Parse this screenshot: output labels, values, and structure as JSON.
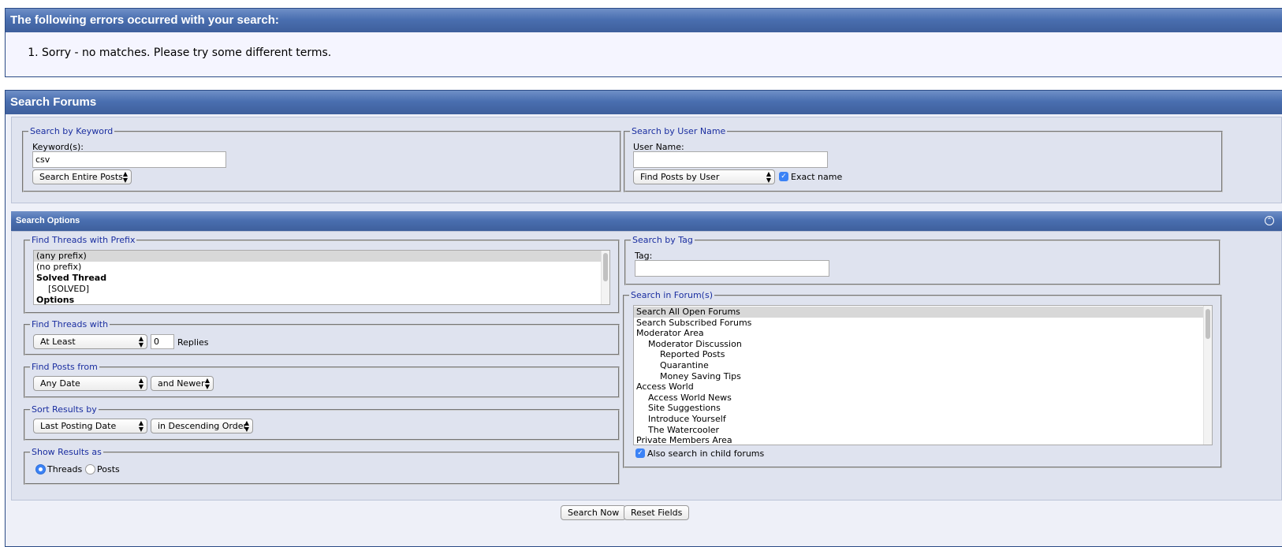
{
  "errors": {
    "title": "The following errors occurred with your search:",
    "items": [
      "Sorry - no matches. Please try some different terms."
    ]
  },
  "search": {
    "title": "Search Forums",
    "keyword": {
      "legend": "Search by Keyword",
      "label": "Keyword(s):",
      "value": "csv",
      "scope": "Search Entire Posts"
    },
    "user": {
      "legend": "Search by User Name",
      "label": "User Name:",
      "value": "",
      "mode": "Find Posts by User",
      "exact_label": "Exact name",
      "exact_checked": true
    },
    "options_title": "Search Options",
    "prefix": {
      "legend": "Find Threads with Prefix",
      "items": [
        {
          "label": "(any prefix)",
          "indent": 0,
          "bold": false,
          "selected": true
        },
        {
          "label": "(no prefix)",
          "indent": 0,
          "bold": false,
          "selected": false
        },
        {
          "label": "Solved Thread",
          "indent": 0,
          "bold": true,
          "selected": false
        },
        {
          "label": "[SOLVED]",
          "indent": 1,
          "bold": false,
          "selected": false
        },
        {
          "label": "Options",
          "indent": 0,
          "bold": true,
          "selected": false
        }
      ]
    },
    "threads_with": {
      "legend": "Find Threads with",
      "mode": "At Least",
      "replies_value": "0",
      "replies_label": "Replies"
    },
    "posts_from": {
      "legend": "Find Posts from",
      "date": "Any Date",
      "direction": "and Newer"
    },
    "sort": {
      "legend": "Sort Results by",
      "field": "Last Posting Date",
      "order": "in Descending Order"
    },
    "show_as": {
      "legend": "Show Results as",
      "threads_label": "Threads",
      "posts_label": "Posts",
      "selected": "Threads"
    },
    "tag": {
      "legend": "Search by Tag",
      "label": "Tag:",
      "value": ""
    },
    "forums": {
      "legend": "Search in Forum(s)",
      "items": [
        {
          "label": "Search All Open Forums",
          "indent": 0,
          "selected": true
        },
        {
          "label": "Search Subscribed Forums",
          "indent": 0,
          "selected": false
        },
        {
          "label": "Moderator Area",
          "indent": 0,
          "selected": false
        },
        {
          "label": "Moderator Discussion",
          "indent": 1,
          "selected": false
        },
        {
          "label": "Reported Posts",
          "indent": 2,
          "selected": false
        },
        {
          "label": "Quarantine",
          "indent": 2,
          "selected": false
        },
        {
          "label": "Money Saving Tips",
          "indent": 2,
          "selected": false
        },
        {
          "label": "Access World",
          "indent": 0,
          "selected": false
        },
        {
          "label": "Access World News",
          "indent": 1,
          "selected": false
        },
        {
          "label": "Site Suggestions",
          "indent": 1,
          "selected": false
        },
        {
          "label": "Introduce Yourself",
          "indent": 1,
          "selected": false
        },
        {
          "label": "The Watercooler",
          "indent": 1,
          "selected": false
        },
        {
          "label": "Private Members Area",
          "indent": 0,
          "selected": false
        }
      ],
      "child_label": "Also search in child forums",
      "child_checked": true
    },
    "buttons": {
      "search_now": "Search Now",
      "reset": "Reset Fields"
    }
  }
}
